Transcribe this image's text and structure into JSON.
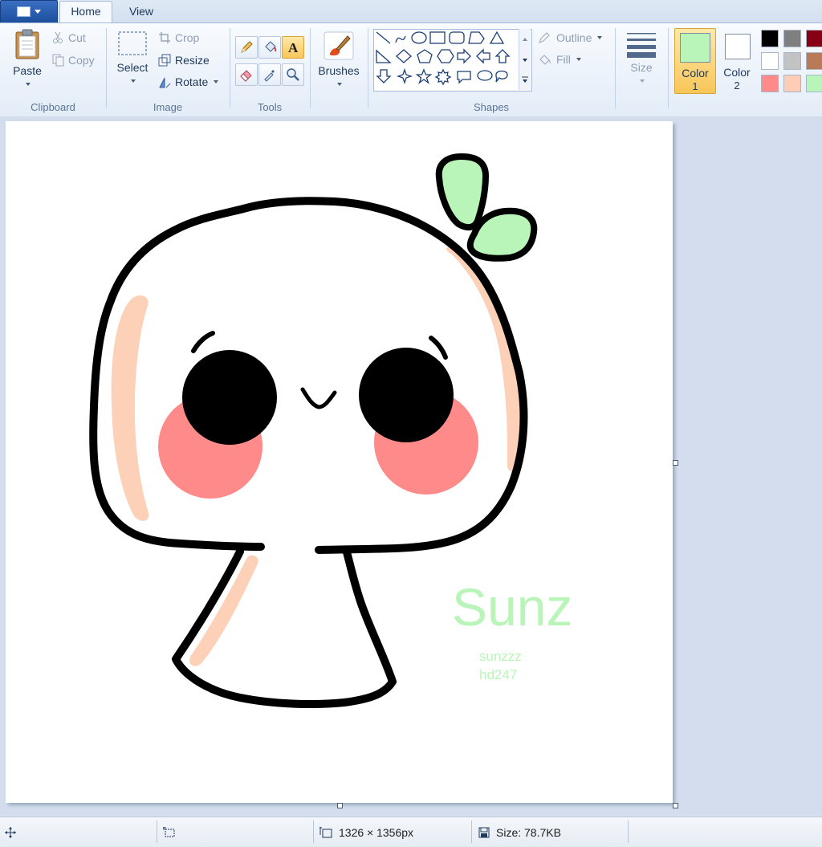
{
  "tabs": {
    "home": "Home",
    "view": "View"
  },
  "clipboard": {
    "paste": "Paste",
    "cut": "Cut",
    "copy": "Copy",
    "label": "Clipboard"
  },
  "image": {
    "select": "Select",
    "crop": "Crop",
    "resize": "Resize",
    "rotate": "Rotate",
    "label": "Image"
  },
  "tools": {
    "label": "Tools",
    "items": [
      "pencil",
      "fill",
      "text",
      "eraser",
      "color-picker",
      "magnifier"
    ],
    "active": "text"
  },
  "brushes": {
    "label": "Brushes"
  },
  "shapes": {
    "label": "Shapes",
    "outline": "Outline",
    "fill": "Fill"
  },
  "size": {
    "label": "Size"
  },
  "colors": {
    "color1_label": "Color",
    "color1_num": "1",
    "color1_value": "#b9f5b9",
    "color2_label": "Color",
    "color2_num": "2",
    "color2_value": "#ffffff",
    "palette": [
      "#000000",
      "#7f7f7f",
      "#880015",
      "#ffffff",
      "#c3c3c3",
      "#b97a57",
      "#ff8a8a",
      "#ffcdb6",
      "#b9f5b9"
    ]
  },
  "canvas": {
    "signature": "Sunz",
    "credit_line1": "sunzzz",
    "credit_line2": "hd247"
  },
  "status": {
    "dimensions": "1326 × 1356px",
    "size": "Size: 78.7KB"
  }
}
